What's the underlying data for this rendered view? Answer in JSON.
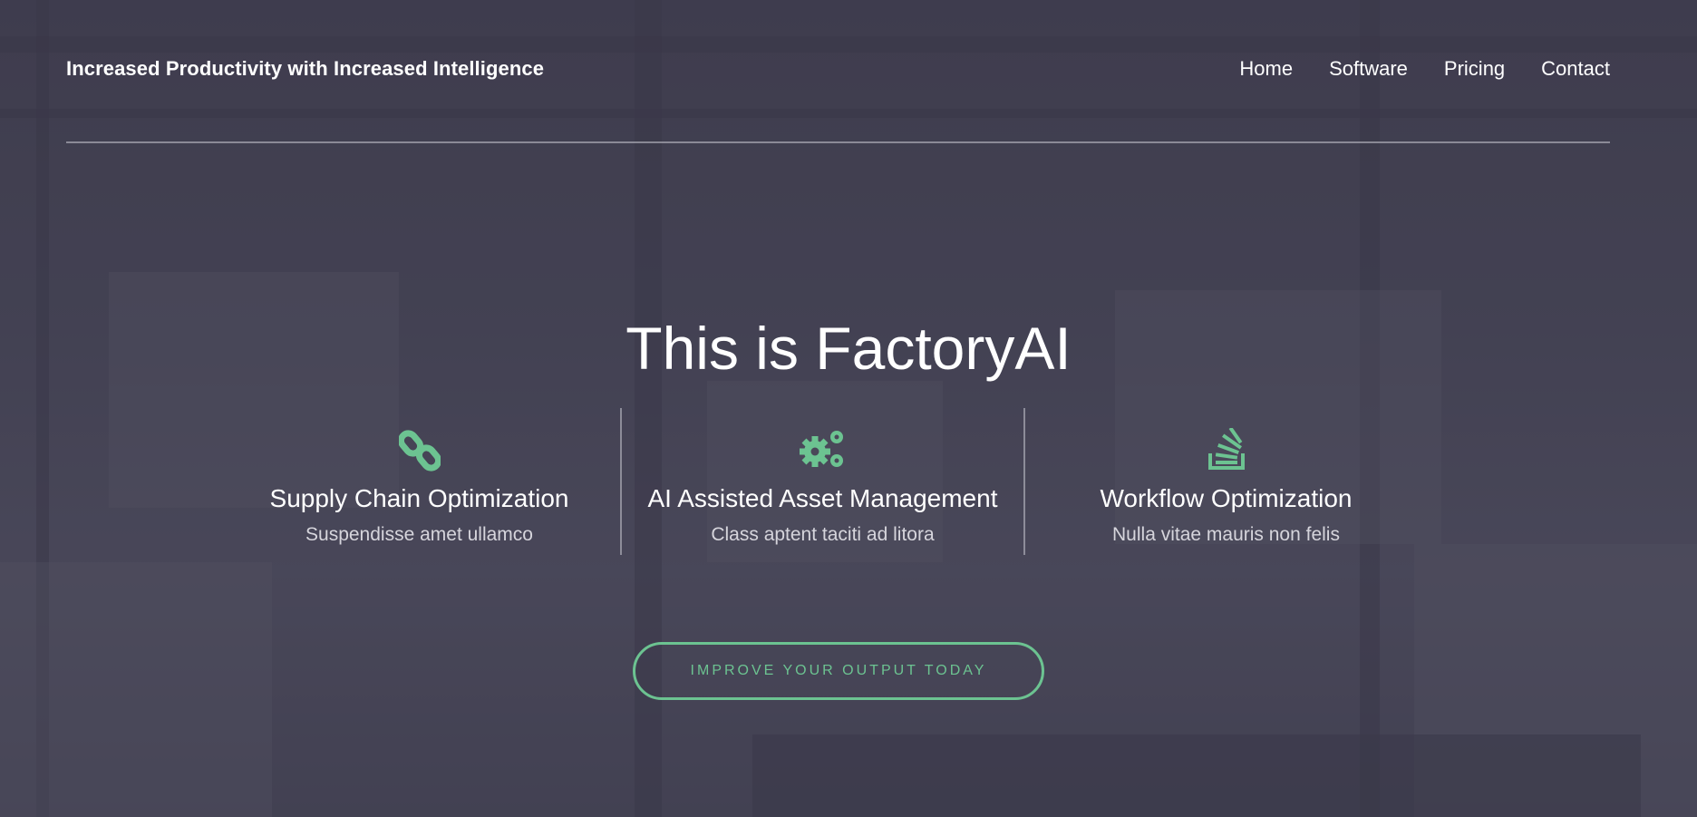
{
  "brand": "Increased Productivity with Increased Intelligence",
  "nav": {
    "items": [
      "Home",
      "Software",
      "Pricing",
      "Contact"
    ]
  },
  "hero": {
    "title": "This is FactoryAI"
  },
  "features": [
    {
      "icon": "chain-link-icon",
      "title": "Supply Chain Optimization",
      "desc": "Suspendisse amet ullamco"
    },
    {
      "icon": "gears-icon",
      "title": "AI Assisted Asset Management",
      "desc": "Class aptent taciti ad litora"
    },
    {
      "icon": "stack-icon",
      "title": "Workflow Optimization",
      "desc": "Nulla vitae mauris non felis"
    }
  ],
  "cta": {
    "label": "IMPROVE YOUR OUTPUT TODAY"
  },
  "colors": {
    "accent": "#6cc391",
    "overlay": "#4a4859"
  }
}
